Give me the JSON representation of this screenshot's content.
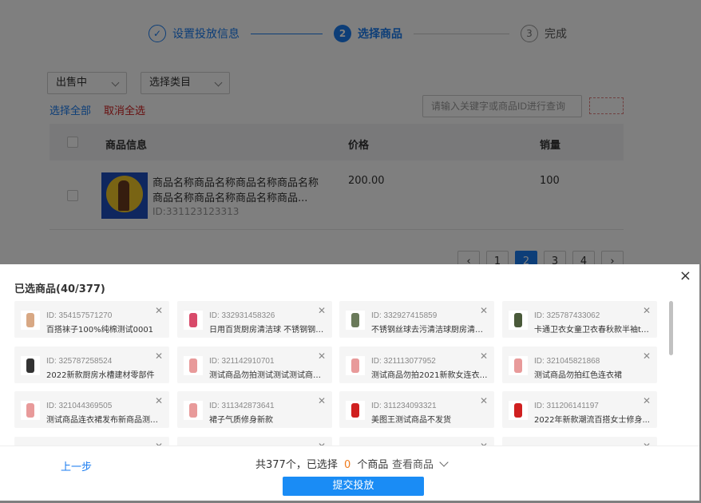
{
  "steps": [
    {
      "num": "✓",
      "label": "设置投放信息",
      "state": "done"
    },
    {
      "num": "2",
      "label": "选择商品",
      "state": "active"
    },
    {
      "num": "3",
      "label": "完成",
      "state": "todo"
    }
  ],
  "filters": {
    "status": "出售中",
    "category": "选择类目"
  },
  "select_all": "选择全部",
  "cancel_all": "取消全选",
  "search_placeholder": "请输入关键字或商品ID进行查询",
  "table": {
    "headers": {
      "info": "商品信息",
      "price": "价格",
      "sales": "销量"
    },
    "row": {
      "name_line1": "商品名称商品名称商品名称商品名称",
      "name_line2": "商品名称商品名称商品名称商品...",
      "id": "ID:331123123313",
      "price": "200.00",
      "sales": "100"
    }
  },
  "pagination": {
    "pages": [
      "1",
      "2",
      "3",
      "4"
    ],
    "current": "2",
    "prev": "‹",
    "next": "›"
  },
  "panel": {
    "title": "已选商品(40/377)",
    "close": "×",
    "items": [
      {
        "id": "ID: 354157571270",
        "name": "百搭袜子100%纯棉测试0001",
        "color": "#d8a884"
      },
      {
        "id": "ID: 332931458326",
        "name": "日用百货厨房清洁球 不锈钢钢丝...",
        "color": "#d84a6a"
      },
      {
        "id": "ID: 332927415859",
        "name": "不锈钢丝球去污清洁球厨房清洁...",
        "color": "#6a7a5a"
      },
      {
        "id": "ID: 325787433062",
        "name": "卡通卫衣女童卫衣春秋款半袖t恤...",
        "color": "#4a5a3a"
      },
      {
        "id": "ID: 325787258524",
        "name": "2022新款厨房水槽建材零部件",
        "color": "#333333"
      },
      {
        "id": "ID: 321142910701",
        "name": "测试商品勿拍测试测试测试商品...",
        "color": "#e89a9a"
      },
      {
        "id": "ID: 321113077952",
        "name": "测试商品勿拍2021新款女连衣裙...",
        "color": "#e89a9a"
      },
      {
        "id": "ID: 321045821868",
        "name": "测试商品勿拍红色连衣裙",
        "color": "#e89a9a"
      },
      {
        "id": "ID: 321044369505",
        "name": "测试商品连衣裙发布新商品测试...",
        "color": "#e89a9a"
      },
      {
        "id": "ID: 311342873641",
        "name": "裙子气质修身新款",
        "color": "#e89a9a"
      },
      {
        "id": "ID: 311234093321",
        "name": "美图王测试商品不发货",
        "color": "#d02020"
      },
      {
        "id": "ID: 311206141197",
        "name": "2022年新款潮流百搭女士修身...",
        "color": "#d02020"
      },
      {
        "id": "",
        "name": "",
        "color": "#e89a9a"
      },
      {
        "id": "",
        "name": "",
        "color": "#333333"
      },
      {
        "id": "",
        "name": "",
        "color": "#9ab8e8"
      },
      {
        "id": "",
        "name": "",
        "color": "#e89a9a"
      }
    ]
  },
  "footer": {
    "prev": "上一步",
    "summary_prefix": "共377个，已选择",
    "summary_count": "0",
    "summary_suffix": "个商品",
    "view": "查看商品",
    "submit": "提交投放"
  },
  "colors": {
    "accent": "#1a7cf0",
    "danger": "#d02020",
    "highlight": "#f07a1a"
  }
}
